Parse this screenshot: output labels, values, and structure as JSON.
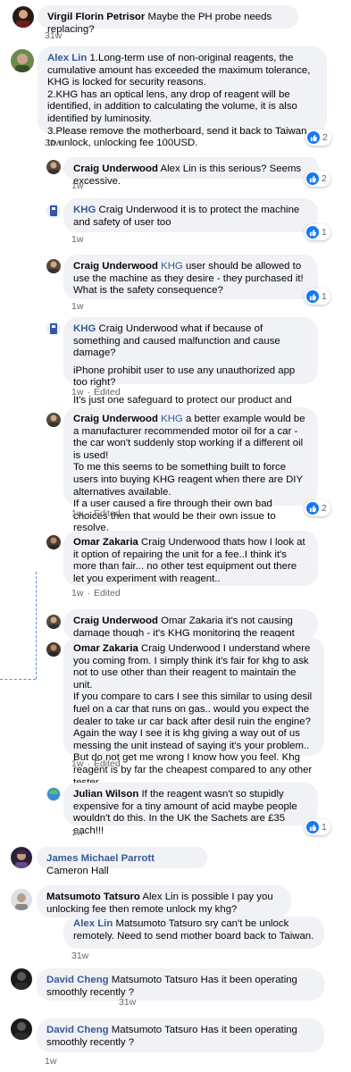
{
  "comments": [
    {
      "author": "Virgil Florin Petrisor",
      "mention": "",
      "text": "Maybe the PH probe needs replacing?",
      "time": "31w",
      "edited": "",
      "reactions": ""
    },
    {
      "author": "Alex Lin",
      "mention": "",
      "lines": [
        "1.Long-term use of non-original reagents, the cumulative amount has exceeded the maximum tolerance, KHG is locked for security reasons.",
        "2.KHG has an optical lens, any drop of reagent will be identified, in addition to calculating the volume, it is also identified by luminosity.",
        "3.Please remove the motherboard, send it back to Taiwan to unlock, unlocking fee 100USD."
      ],
      "time": "31w",
      "reactions": "2"
    },
    {
      "author": "Craig Underwood",
      "text": "Alex Lin is this serious? Seems excessive.",
      "time": "1w",
      "reactions": "2"
    },
    {
      "author": "KHG",
      "text": "Craig Underwood it is to protect the machine and safety of user too",
      "time": "1w",
      "reactions": "1"
    },
    {
      "author": "Craig Underwood",
      "mention": "KHG",
      "text": "user should be allowed to use the machine as they desire - they purchased it! What is the safety consequence?",
      "time": "1w",
      "reactions": "1"
    },
    {
      "author": "KHG",
      "lines": [
        "Craig Underwood what if because of something and caused malfunction and cause damage?",
        "iPhone prohibit user to use any unauthorized app too right?",
        "It's just one safeguard to protect our product and the user"
      ],
      "time": "1w",
      "edited": "Edited"
    },
    {
      "author": "Craig Underwood",
      "mention": "KHG",
      "lines": [
        "a better example would be a manufacturer recommended motor oil for a car - the car won't suddenly stop working if a different oil is used!",
        "To me this seems to be something built to force users into buying KHG reagent when there are DIY alternatives available.",
        "If a user caused a fire through their own bad choices then that would be their own issue to resolve."
      ],
      "time": "1w",
      "edited": "Edited",
      "reactions": "2"
    },
    {
      "author": "Omar Zakaria",
      "text": "Craig Underwood thats how I look at it option of repairing the unit for a fee..I think it's more than fair... no other test equipment out there let you experiment with reagent..",
      "time": "1w",
      "edited": "Edited"
    },
    {
      "author": "Craig Underwood",
      "text": "Omar Zakaria it's not causing damage though - it's KHG monitoring the reagent used and setting a"
    },
    {
      "author": "Omar Zakaria",
      "lines": [
        "Craig Underwood I understand where you coming from. I simply think it's fair for khg to ask not to use other than their reagent to maintain the unit.",
        "If you compare to cars I see this similar to using desil fuel on a car that runs on gas.. would you expect the dealer to take ur car back after desil ruin the engine?",
        "Again the way I see it is khg giving a way out of us messing the unit instead of saying it's your problem..",
        "But do not get me wrong I know how you feel. Khg reagent is by far the cheapest compared to any other tester."
      ],
      "time": "1w",
      "edited": "Edited"
    },
    {
      "author": "Julian Wilson",
      "text": "If the reagent wasn't so stupidly expensive for a tiny amount of acid maybe people wouldn't do this. In the UK the Sachets are £35 each!!!",
      "time": "1w",
      "reactions": "1"
    },
    {
      "author": "James Michael Parrott",
      "text": "Cameron Hall"
    },
    {
      "author": "Matsumoto Tatsuro",
      "text": "Alex Lin is possible I pay you unlocking fee then remote unlock my khg?"
    },
    {
      "author": "Alex Lin",
      "text": "Matsumoto Tatsuro sry can't be unlock remotely. Need to send mother board back to Taiwan.",
      "time": "31w"
    },
    {
      "author": "David Cheng",
      "text": "Matsumoto Tatsuro Has it been operating smoothly recently ?",
      "time": "31w"
    },
    {
      "author": "David Cheng",
      "text": "Matsumoto Tatsuro Has it been operating smoothly recently ?",
      "time": "1w"
    }
  ],
  "colors": {
    "bubble": "#f0f2f5",
    "link": "#385898",
    "meta": "#65676b",
    "like": "#1877f2"
  },
  "icons": {
    "reaction": "like-thumb-icon"
  }
}
